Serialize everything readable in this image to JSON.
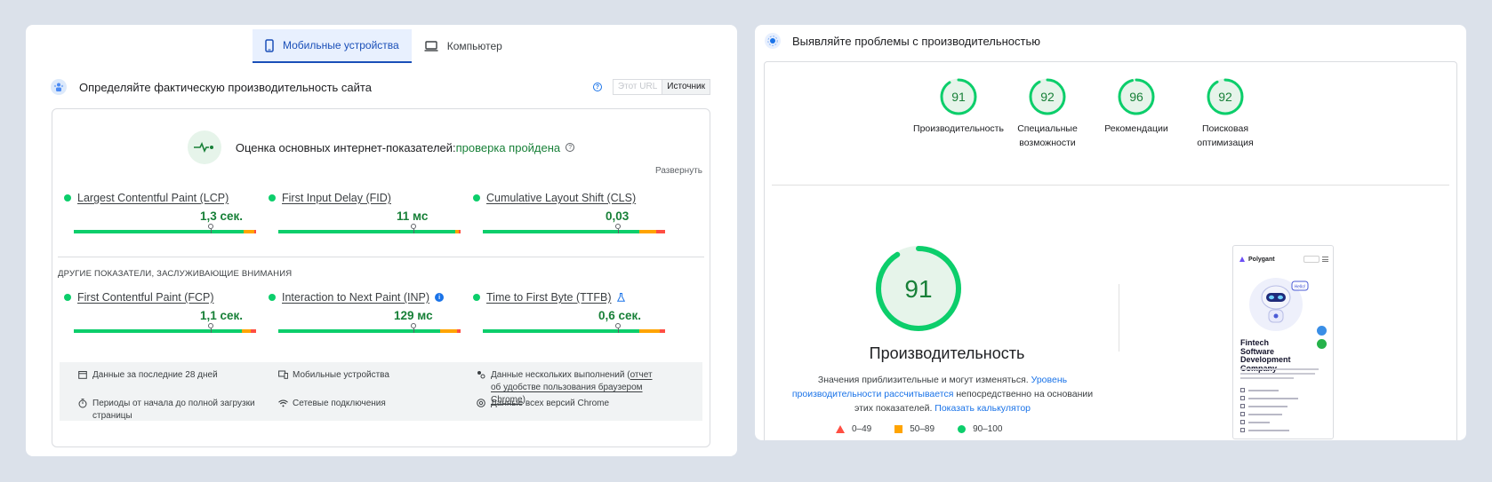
{
  "left": {
    "tabs": [
      {
        "label": "Мобильные устройства",
        "icon": "smartphone-icon",
        "active": true
      },
      {
        "label": "Компьютер",
        "icon": "laptop-icon",
        "active": false
      }
    ],
    "section_title": "Определяйте фактическую производительность сайта",
    "toggle": {
      "url": "Этот URL",
      "origin": "Источник"
    },
    "cwv": {
      "label": "Оценка основных интернет-показателей:",
      "status": "проверка пройдена"
    },
    "expand": "Развернуть",
    "metrics": [
      {
        "name": "Largest Contentful Paint (LCP)",
        "value": "1,3 сек.",
        "segments": [
          0.93,
          0.06,
          0.01
        ],
        "marker": 0.75
      },
      {
        "name": "First Input Delay (FID)",
        "value": "11 мс",
        "segments": [
          0.97,
          0.02,
          0.01
        ],
        "marker": 0.74
      },
      {
        "name": "Cumulative Layout Shift (CLS)",
        "value": "0,03",
        "segments": [
          0.86,
          0.09,
          0.05
        ],
        "marker": 0.74
      }
    ],
    "other_title": "ДРУГИЕ ПОКАЗАТЕЛИ, ЗАСЛУЖИВАЮЩИЕ ВНИМАНИЯ",
    "other_metrics": [
      {
        "name": "First Contentful Paint (FCP)",
        "value": "1,1 сек.",
        "segments": [
          0.92,
          0.05,
          0.03
        ],
        "marker": 0.75
      },
      {
        "name": "Interaction to Next Paint (INP)",
        "value": "129 мс",
        "segments": [
          0.89,
          0.09,
          0.02
        ],
        "marker": 0.74
      },
      {
        "name": "Time to First Byte (TTFB)",
        "value": "0,6 сек.",
        "segments": [
          0.86,
          0.11,
          0.03
        ],
        "marker": 0.74
      }
    ],
    "footer": {
      "period": "Данные за последние 28 дней",
      "device": "Мобильные устройства",
      "runs_prefix": "Данные нескольких выполнений (",
      "runs_link": "отчет об удобстве пользования браузером Chrome",
      "runs_suffix": ")",
      "load": "Периоды от начала до полной загрузки страницы",
      "network": "Сетевые подключения",
      "chrome": "Данные всех версий Chrome"
    }
  },
  "right": {
    "title": "Выявляйте проблемы с производительностью",
    "scores": [
      {
        "value": "91",
        "label": "Производительность"
      },
      {
        "value": "92",
        "label": "Специальные возможности"
      },
      {
        "value": "96",
        "label": "Рекомендации"
      },
      {
        "value": "92",
        "label": "Поисковая оптимизация"
      }
    ],
    "main_score": "91",
    "main_title": "Производительность",
    "desc": {
      "part1": "Значения приблизительные и могут изменяться. ",
      "link1": "Уровень производительности рассчитывается",
      "part2": " непосредственно на основании этих показателей. ",
      "link2": "Показать калькулятор"
    },
    "legend": [
      "0–49",
      "50–89",
      "90–100"
    ],
    "preview": {
      "brand": "Polygant",
      "heading": "Fintech Software Development Company",
      "badge": "Hello!"
    },
    "colors": {
      "pass": "#0cce6b",
      "average": "#ffa400",
      "fail": "#ff4e42",
      "link": "#1a73e8"
    }
  }
}
